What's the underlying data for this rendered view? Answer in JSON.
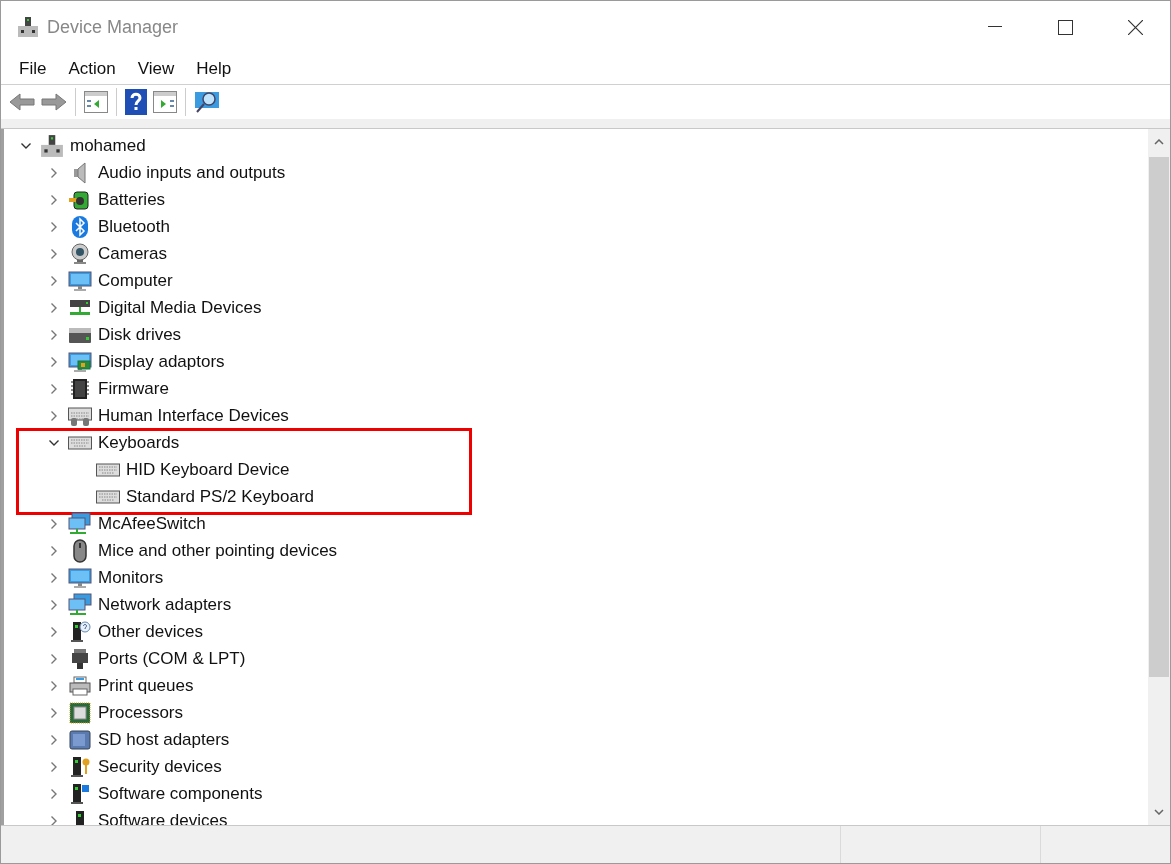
{
  "window": {
    "title": "Device Manager"
  },
  "menu": [
    "File",
    "Action",
    "View",
    "Help"
  ],
  "tree": {
    "root": {
      "label": "mohamed",
      "expanded": true,
      "children": [
        {
          "label": "Audio inputs and outputs",
          "expanded": false,
          "highlighted": false
        },
        {
          "label": "Batteries",
          "expanded": false,
          "highlighted": false
        },
        {
          "label": "Bluetooth",
          "expanded": false,
          "highlighted": false
        },
        {
          "label": "Cameras",
          "expanded": false,
          "highlighted": false
        },
        {
          "label": "Computer",
          "expanded": false,
          "highlighted": false
        },
        {
          "label": "Digital Media Devices",
          "expanded": false,
          "highlighted": false
        },
        {
          "label": "Disk drives",
          "expanded": false,
          "highlighted": false
        },
        {
          "label": "Display adaptors",
          "expanded": false,
          "highlighted": false
        },
        {
          "label": "Firmware",
          "expanded": false,
          "highlighted": false
        },
        {
          "label": "Human Interface Devices",
          "expanded": false,
          "highlighted": false
        },
        {
          "label": "Keyboards",
          "expanded": true,
          "highlighted": true,
          "children": [
            {
              "label": "HID Keyboard Device"
            },
            {
              "label": "Standard PS/2 Keyboard"
            }
          ]
        },
        {
          "label": "McAfeeSwitch",
          "expanded": false,
          "highlighted": false
        },
        {
          "label": "Mice and other pointing devices",
          "expanded": false,
          "highlighted": false
        },
        {
          "label": "Monitors",
          "expanded": false,
          "highlighted": false
        },
        {
          "label": "Network adapters",
          "expanded": false,
          "highlighted": false
        },
        {
          "label": "Other devices",
          "expanded": false,
          "highlighted": false
        },
        {
          "label": "Ports (COM & LPT)",
          "expanded": false,
          "highlighted": false
        },
        {
          "label": "Print queues",
          "expanded": false,
          "highlighted": false
        },
        {
          "label": "Processors",
          "expanded": false,
          "highlighted": false
        },
        {
          "label": "SD host adapters",
          "expanded": false,
          "highlighted": false
        },
        {
          "label": "Security devices",
          "expanded": false,
          "highlighted": false
        },
        {
          "label": "Software components",
          "expanded": false,
          "highlighted": false
        },
        {
          "label": "Software devices",
          "expanded": false,
          "highlighted": false
        }
      ]
    }
  }
}
